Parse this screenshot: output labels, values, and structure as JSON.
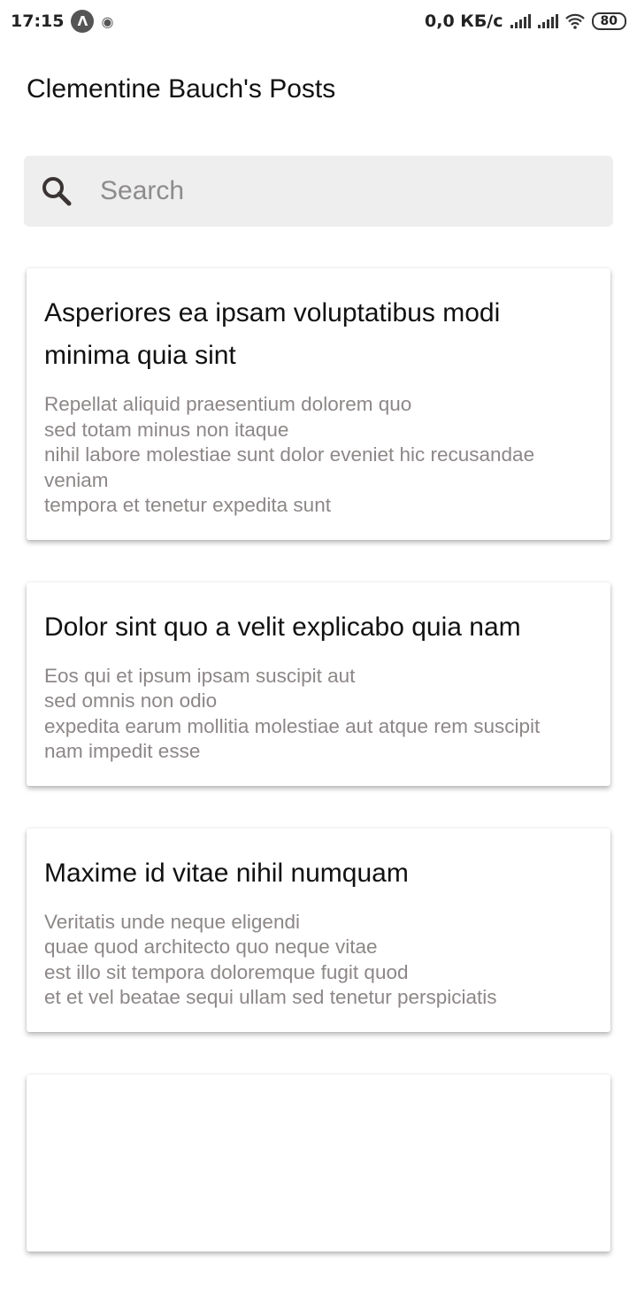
{
  "status_bar": {
    "time": "17:15",
    "network_speed": "0,0 КБ/с",
    "battery": "80"
  },
  "header": {
    "title": "Clementine Bauch's Posts"
  },
  "search": {
    "placeholder": "Search",
    "value": ""
  },
  "posts": [
    {
      "title": "Asperiores ea ipsam voluptatibus modi minima quia sint",
      "body": "Repellat aliquid praesentium dolorem quo\nsed totam minus non itaque\nnihil labore molestiae sunt dolor eveniet hic recusandae veniam\ntempora et tenetur expedita sunt"
    },
    {
      "title": "Dolor sint quo a velit explicabo quia nam",
      "body": "Eos qui et ipsum ipsam suscipit aut\nsed omnis non odio\nexpedita earum mollitia molestiae aut atque rem suscipit\nnam impedit esse"
    },
    {
      "title": "Maxime id vitae nihil numquam",
      "body": "Veritatis unde neque eligendi\nquae quod architecto quo neque vitae\nest illo sit tempora doloremque fugit quod\net et vel beatae sequi ullam sed tenetur perspiciatis"
    },
    {
      "title": "",
      "body": ""
    }
  ]
}
